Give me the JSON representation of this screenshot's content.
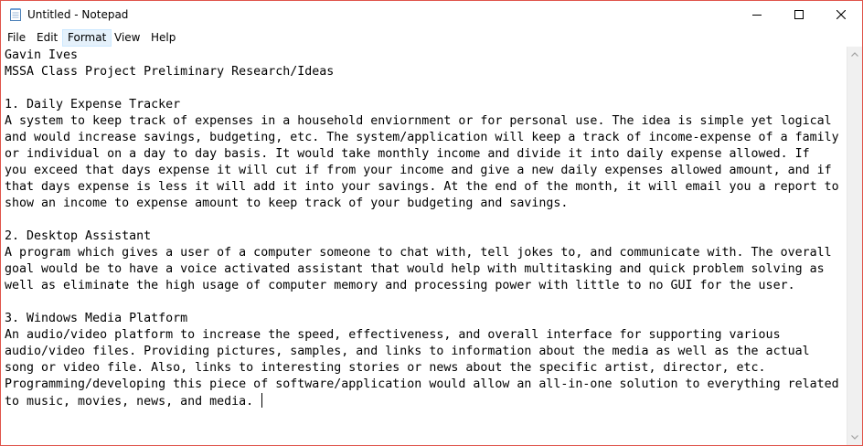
{
  "window": {
    "title": "Untitled - Notepad",
    "accent_border": "#e0544a"
  },
  "titlebar": {
    "app_icon": "notepad-icon",
    "minimize_icon": "minimize-icon",
    "maximize_icon": "maximize-icon",
    "close_icon": "close-icon"
  },
  "menu": {
    "items": [
      {
        "label": "File"
      },
      {
        "label": "Edit"
      },
      {
        "label": "Format",
        "active": true
      },
      {
        "label": "View"
      },
      {
        "label": "Help"
      }
    ]
  },
  "editor": {
    "content": "Gavin Ives\nMSSA Class Project Preliminary Research/Ideas\n\n1. Daily Expense Tracker\nA system to keep track of expenses in a household enviornment or for personal use. The idea is simple yet logical\nand would increase savings, budgeting, etc. The system/application will keep a track of income-expense of a family\nor individual on a day to day basis. It would take monthly income and divide it into daily expense allowed. If\nyou exceed that days expense it will cut if from your income and give a new daily expenses allowed amount, and if\nthat days expense is less it will add it into your savings. At the end of the month, it will email you a report to\nshow an income to expense amount to keep track of your budgeting and savings.\n\n2. Desktop Assistant\nA program which gives a user of a computer someone to chat with, tell jokes to, and communicate with. The overall\ngoal would be to have a voice activated assistant that would help with multitasking and quick problem solving as\nwell as eliminate the high usage of computer memory and processing power with little to no GUI for the user.\n\n3. Windows Media Platform\nAn audio/video platform to increase the speed, effectiveness, and overall interface for supporting various\naudio/video files. Providing pictures, samples, and links to information about the media as well as the actual\nsong or video file. Also, links to interesting stories or news about the specific artist, director, etc.\nProgramming/developing this piece of software/application would allow an all-in-one solution to everything related\nto music, movies, news, and media. "
  },
  "scrollbar": {
    "up_icon": "scroll-up-arrow-icon",
    "down_icon": "scroll-down-arrow-icon"
  }
}
